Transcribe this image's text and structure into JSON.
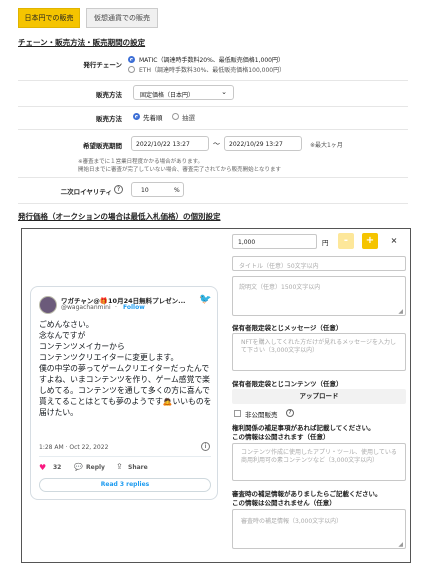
{
  "tabs": {
    "jpy": "日本円での販売",
    "crypto": "仮想通貨での販売"
  },
  "section1": {
    "title": "チェーン・販売方法・販売期間の設定",
    "chain_label": "発行チェーン",
    "chain_options": [
      "MATIC（調達時手数料20%、最低販売価格1,000円）",
      "ETH（調達時手数料30%、最低販売価格100,000円）"
    ],
    "method_label": "販売方法",
    "method_value": "固定価格（日本円）",
    "method2_label": "販売方法",
    "method2_options": [
      "先着順",
      "抽選"
    ],
    "period_label": "希望販売期間",
    "period_start": "2022/10/22 13:27",
    "period_sep": "〜",
    "period_end": "2022/10/29 13:27",
    "period_note": "※最大1ヶ月",
    "notes": [
      "※審査までに１営業日程度かかる場合があります。",
      "開始日までに審査が完了していない場合、審査完了されてから販売開始となります"
    ],
    "royalty_label": "二次ロイヤリティ",
    "royalty_help": "?",
    "royalty_value": "10",
    "royalty_unit": "%"
  },
  "section2": {
    "title": "発行価格（オークションの場合は最低入札価格）の個別設定"
  },
  "item": {
    "price_value": "1,000",
    "price_unit": "円",
    "minus": "-",
    "plus": "+",
    "close": "×",
    "title_placeholder": "タイトル（任意）50文字以内",
    "desc_placeholder": "説明文（任意）1500文字以内",
    "holder_msg_label": "保有者限定袋とじメッセージ（任意）",
    "holder_msg_placeholder": "NFTを購入してくれた方だけが見れるメッセージを入力して下さい（3,000文字以内）",
    "holder_content_label": "保有者限定袋とじコンテンツ（任意）",
    "upload_label": "アップロード",
    "private_label": "非公開販売",
    "private_help": "?",
    "rights_label": "権利関係の補足事項があれば記載してください。",
    "rights_sub": "この情報は公開されます（任意）",
    "rights_placeholder": "コンテンツ作成に使用したアプリ・ツール、使用している商用利用可の素コンテンツなど（3,000文字以内）",
    "review_label": "審査時の補足情報がありましたらご記載ください。",
    "review_sub": "この情報は公開されません（任意）",
    "review_placeholder": "審査時の補足情報（3,000文字以内）"
  },
  "tweet": {
    "name": "ワガチャン@🎁10月24日無料プレゼン...",
    "handle": "@wagachanmini",
    "follow": "Follow",
    "body": "ごめんなさい。\n念なんですが\nコンテンツメイカーから\nコンテンツクリエイターに変更します。\n僕の中学の夢ってゲームクリエイターだったんですよね、いまコンテンツを作り、ゲーム感覚で楽しめてる。コンテンツを通して多くの方に喜んで貰えてることはとても夢のようです🙇いいものを届けたい。",
    "time": "1:28 AM · Oct 22, 2022",
    "likes": "32",
    "reply": "Reply",
    "share": "Share",
    "read_replies": "Read 3 replies"
  },
  "colors": {
    "accent": "#f5c400",
    "radio": "#3d6fd6",
    "twitter": "#1d9bf0",
    "like": "#f91880"
  }
}
